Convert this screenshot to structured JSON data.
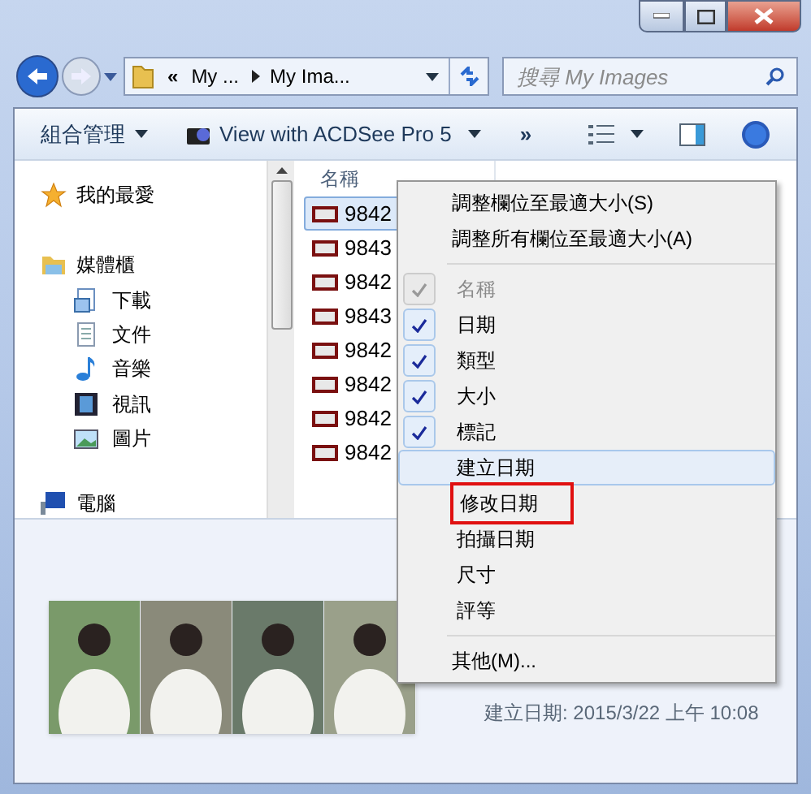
{
  "address": {
    "back_enabled": true,
    "forward_enabled": false,
    "overflow": "«",
    "crumbs": [
      "My ...",
      "My Ima..."
    ]
  },
  "search": {
    "placeholder": "搜尋 My Images"
  },
  "toolbar": {
    "organize": "組合管理",
    "open_with": "View with ACDSee Pro 5",
    "more": "»"
  },
  "nav": {
    "favorites": "我的最愛",
    "libraries": {
      "label": "媒體櫃",
      "children": [
        {
          "label": "下載",
          "kind": "download"
        },
        {
          "label": "文件",
          "kind": "document"
        },
        {
          "label": "音樂",
          "kind": "music"
        },
        {
          "label": "視訊",
          "kind": "video"
        },
        {
          "label": "圖片",
          "kind": "picture"
        }
      ]
    },
    "computer": "電腦"
  },
  "table": {
    "columns": [
      "名稱"
    ],
    "rows": [
      {
        "name": "9842",
        "selected": true
      },
      {
        "name": "9843",
        "selected": false
      },
      {
        "name": "9842",
        "selected": false
      },
      {
        "name": "9843",
        "selected": false
      },
      {
        "name": "9842",
        "selected": false
      },
      {
        "name": "9842",
        "selected": false
      },
      {
        "name": "9842",
        "selected": false
      },
      {
        "name": "9842",
        "selected": false
      }
    ]
  },
  "context_menu": {
    "top": [
      "調整欄位至最適大小(S)",
      "調整所有欄位至最適大小(A)"
    ],
    "columns": [
      {
        "label": "名稱",
        "checked": true,
        "disabled": true,
        "hovered": false,
        "marked": false
      },
      {
        "label": "日期",
        "checked": true,
        "disabled": false,
        "hovered": false,
        "marked": false
      },
      {
        "label": "類型",
        "checked": true,
        "disabled": false,
        "hovered": false,
        "marked": false
      },
      {
        "label": "大小",
        "checked": true,
        "disabled": false,
        "hovered": false,
        "marked": false
      },
      {
        "label": "標記",
        "checked": true,
        "disabled": false,
        "hovered": false,
        "marked": false
      },
      {
        "label": "建立日期",
        "checked": false,
        "disabled": false,
        "hovered": true,
        "marked": false
      },
      {
        "label": "修改日期",
        "checked": false,
        "disabled": false,
        "hovered": false,
        "marked": true
      },
      {
        "label": "拍攝日期",
        "checked": false,
        "disabled": false,
        "hovered": false,
        "marked": false
      },
      {
        "label": "尺寸",
        "checked": false,
        "disabled": false,
        "hovered": false,
        "marked": false
      },
      {
        "label": "評等",
        "checked": false,
        "disabled": false,
        "hovered": false,
        "marked": false
      }
    ],
    "more": "其他(M)..."
  },
  "details": {
    "created": "建立日期: 2015/3/22 上午 10:08"
  }
}
